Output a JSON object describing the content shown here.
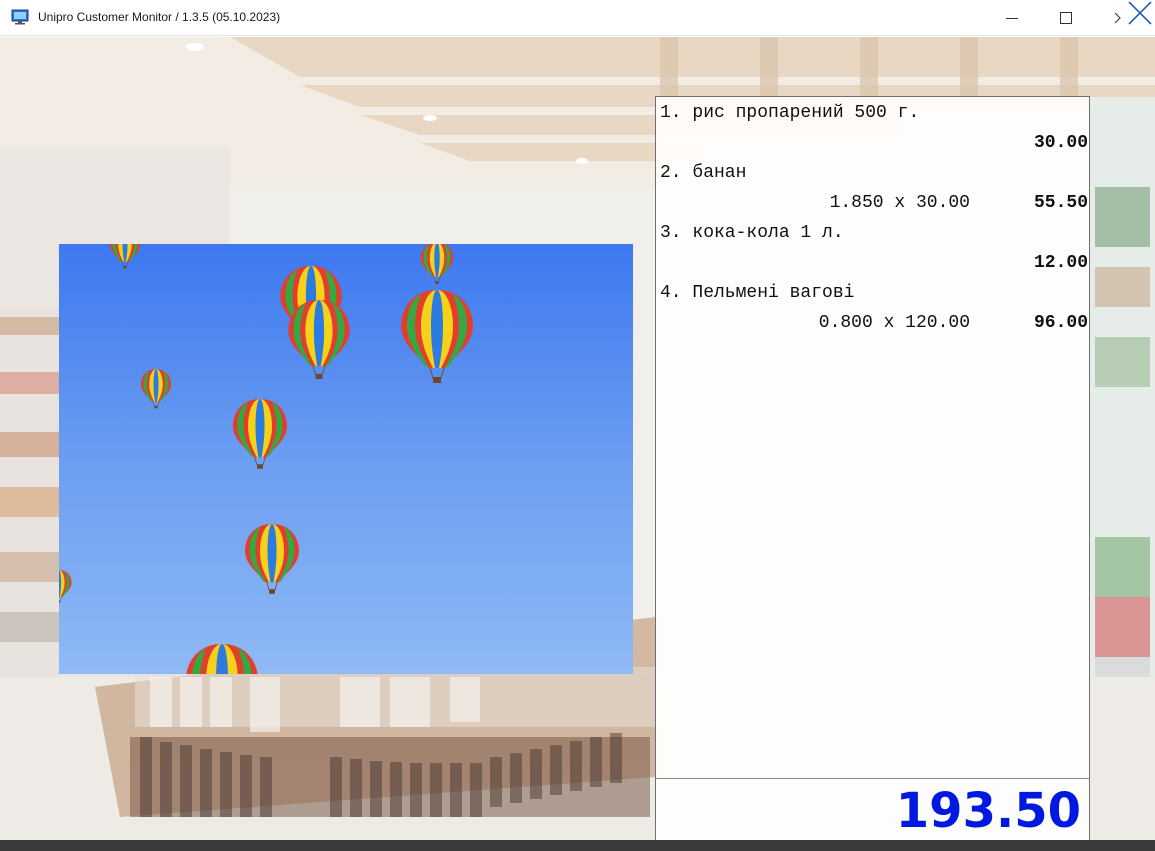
{
  "window": {
    "title": "Unipro Customer Monitor / 1.3.5 (05.10.2023)",
    "app_icon": "monitor-icon",
    "controls": [
      "minimize-icon",
      "maximize-icon",
      "close-icon"
    ]
  },
  "receipt": {
    "items": [
      {
        "name": "1. рис пропарений 500 г.",
        "qty": "",
        "sum": "30.00"
      },
      {
        "name": "2. банан",
        "qty": "1.850 x 30.00",
        "sum": "55.50"
      },
      {
        "name": "3. кока-кола 1 л.",
        "qty": "",
        "sum": "12.00"
      },
      {
        "name": "4. Пельмені вагові",
        "qty": "0.800 x 120.00",
        "sum": "96.00"
      }
    ],
    "total": "193.50"
  },
  "colors": {
    "total": "#0018e0",
    "ad_sky_top": "#3d78f0",
    "ad_sky_bottom": "#8fbaf5"
  }
}
